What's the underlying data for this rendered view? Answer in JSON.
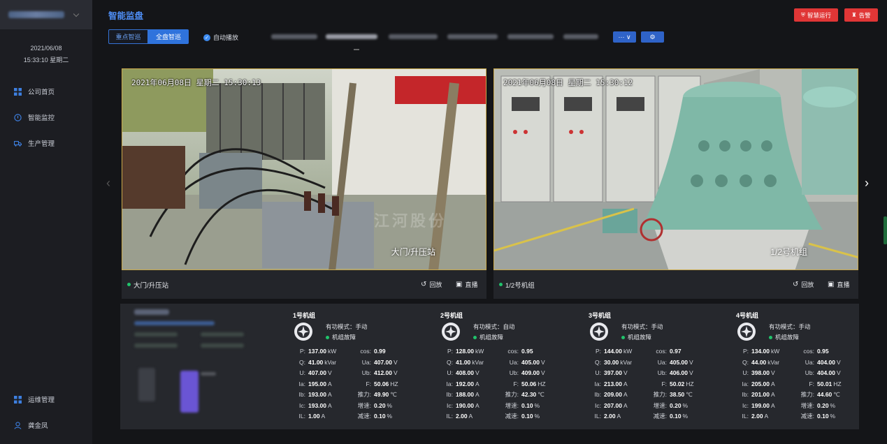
{
  "sidebar": {
    "date": "2021/06/08",
    "time_weekday": "15:33:10 星期二",
    "nav_top": [
      {
        "label": "公司首页",
        "icon": "grid-icon"
      },
      {
        "label": "智能监控",
        "icon": "gauge-icon"
      },
      {
        "label": "生产管理",
        "icon": "truck-icon"
      }
    ],
    "nav_bottom": [
      {
        "label": "运维管理",
        "icon": "grid-icon"
      },
      {
        "label": "龚金凤",
        "icon": "user-icon"
      }
    ]
  },
  "header": {
    "title": "智能监盘",
    "btn_run": "智慧运行",
    "btn_alarm": "告警"
  },
  "tabs": {
    "seg_key": "重点智巡",
    "seg_all": "全盘智巡",
    "autoplay": "自动播放",
    "more_btn": "··· ∨",
    "settings_btn": "⚙"
  },
  "cameras": [
    {
      "osd": "2021年06月08日 星期二 15:30:13",
      "overlay": "大门/升压站",
      "name": "大门/升压站",
      "playback": "回放",
      "live": "直播"
    },
    {
      "osd": "2021年06月08日 星期二 15:30:12",
      "overlay": "1/2号机组",
      "name": "1/2号机组",
      "playback": "回放",
      "live": "直播"
    }
  ],
  "units": [
    {
      "name": "1号机组",
      "mode": "有功模式：手动",
      "status": "机组故障",
      "left": [
        [
          "P:",
          "137.00",
          "kW"
        ],
        [
          "Q:",
          "41.00",
          "kVar"
        ],
        [
          "U:",
          "407.00",
          "V"
        ],
        [
          "Ia:",
          "195.00",
          "A"
        ],
        [
          "Ib:",
          "193.00",
          "A"
        ],
        [
          "Ic:",
          "193.00",
          "A"
        ],
        [
          "IL:",
          "1.00",
          "A"
        ]
      ],
      "right": [
        [
          "cos:",
          "0.99",
          ""
        ],
        [
          "Ua:",
          "407.00",
          "V"
        ],
        [
          "Ub:",
          "412.00",
          "V"
        ],
        [
          "F:",
          "50.06",
          "HZ"
        ],
        [
          "推力:",
          "49.90",
          "℃"
        ],
        [
          "增速:",
          "0.20",
          "%"
        ],
        [
          "减速:",
          "0.10",
          "%"
        ]
      ]
    },
    {
      "name": "2号机组",
      "mode": "有功模式：自动",
      "status": "机组故障",
      "left": [
        [
          "P:",
          "128.00",
          "kW"
        ],
        [
          "Q:",
          "41.00",
          "kVar"
        ],
        [
          "U:",
          "408.00",
          "V"
        ],
        [
          "Ia:",
          "192.00",
          "A"
        ],
        [
          "Ib:",
          "188.00",
          "A"
        ],
        [
          "Ic:",
          "190.00",
          "A"
        ],
        [
          "IL:",
          "2.00",
          "A"
        ]
      ],
      "right": [
        [
          "cos:",
          "0.95",
          ""
        ],
        [
          "Ua:",
          "405.00",
          "V"
        ],
        [
          "Ub:",
          "409.00",
          "V"
        ],
        [
          "F:",
          "50.06",
          "HZ"
        ],
        [
          "推力:",
          "42.30",
          "℃"
        ],
        [
          "增速:",
          "0.10",
          "%"
        ],
        [
          "减速:",
          "0.10",
          "%"
        ]
      ]
    },
    {
      "name": "3号机组",
      "mode": "有功模式：手动",
      "status": "机组故障",
      "left": [
        [
          "P:",
          "144.00",
          "kW"
        ],
        [
          "Q:",
          "30.00",
          "kVar"
        ],
        [
          "U:",
          "397.00",
          "V"
        ],
        [
          "Ia:",
          "213.00",
          "A"
        ],
        [
          "Ib:",
          "209.00",
          "A"
        ],
        [
          "Ic:",
          "207.00",
          "A"
        ],
        [
          "IL:",
          "2.00",
          "A"
        ]
      ],
      "right": [
        [
          "cos:",
          "0.97",
          ""
        ],
        [
          "Ua:",
          "405.00",
          "V"
        ],
        [
          "Ub:",
          "406.00",
          "V"
        ],
        [
          "F:",
          "50.02",
          "HZ"
        ],
        [
          "推力:",
          "38.50",
          "℃"
        ],
        [
          "增速:",
          "0.20",
          "%"
        ],
        [
          "减速:",
          "0.10",
          "%"
        ]
      ]
    },
    {
      "name": "4号机组",
      "mode": "有功模式：手动",
      "status": "机组故障",
      "left": [
        [
          "P:",
          "134.00",
          "kW"
        ],
        [
          "Q:",
          "44.00",
          "kVar"
        ],
        [
          "U:",
          "398.00",
          "V"
        ],
        [
          "Ia:",
          "205.00",
          "A"
        ],
        [
          "Ib:",
          "201.00",
          "A"
        ],
        [
          "Ic:",
          "199.00",
          "A"
        ],
        [
          "IL:",
          "2.00",
          "A"
        ]
      ],
      "right": [
        [
          "cos:",
          "0.95",
          ""
        ],
        [
          "Ua:",
          "404.00",
          "V"
        ],
        [
          "Ub:",
          "404.00",
          "V"
        ],
        [
          "F:",
          "50.01",
          "HZ"
        ],
        [
          "推力:",
          "44.60",
          "℃"
        ],
        [
          "增速:",
          "0.20",
          "%"
        ],
        [
          "减速:",
          "0.10",
          "%"
        ]
      ]
    }
  ],
  "colors": {
    "accent": "#2f73dc",
    "alarm": "#e03636",
    "ok": "#20c36b",
    "frame": "#c9a84b"
  }
}
